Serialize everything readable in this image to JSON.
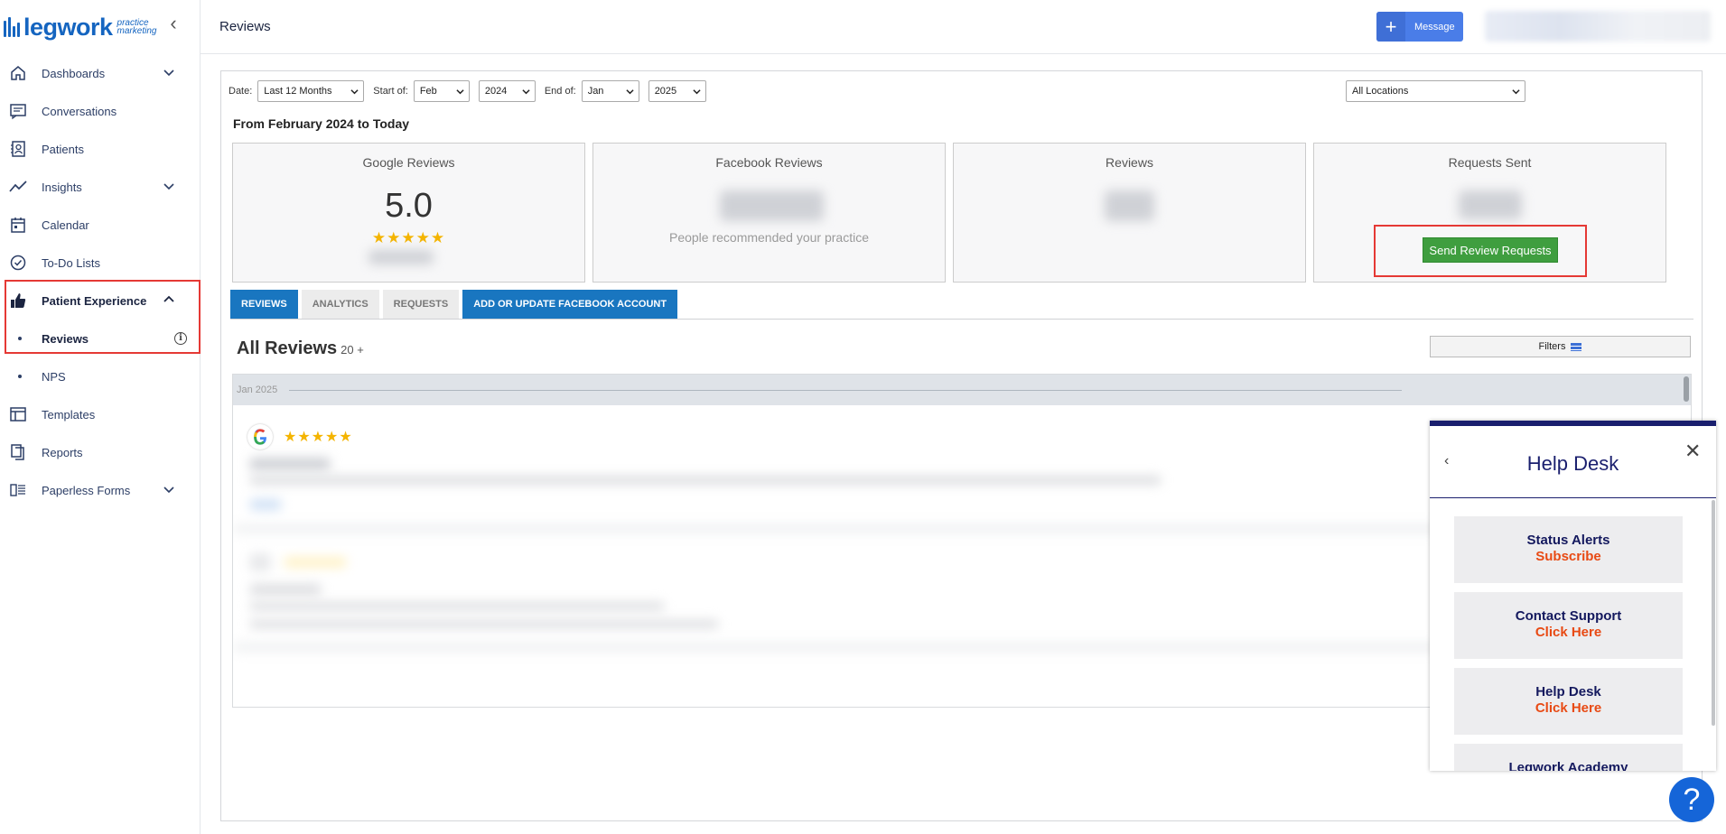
{
  "brand": {
    "name": "legwork",
    "sub1": "practice",
    "sub2": "marketing"
  },
  "sidebar": {
    "items": [
      {
        "label": "Dashboards",
        "icon": "home-icon"
      },
      {
        "label": "Conversations",
        "icon": "chat-icon"
      },
      {
        "label": "Patients",
        "icon": "contact-icon"
      },
      {
        "label": "Insights",
        "icon": "trend-icon"
      },
      {
        "label": "Calendar",
        "icon": "calendar-icon"
      },
      {
        "label": "To-Do Lists",
        "icon": "check-circle-icon"
      },
      {
        "label": "Patient Experience",
        "icon": "thumbs-up-icon"
      },
      {
        "label": "Reviews"
      },
      {
        "label": "NPS"
      },
      {
        "label": "Templates",
        "icon": "table-icon"
      },
      {
        "label": "Reports",
        "icon": "copy-icon"
      },
      {
        "label": "Paperless Forms",
        "icon": "forms-icon"
      }
    ],
    "info_symbol": "i"
  },
  "header": {
    "title": "Reviews",
    "message_label": "Message",
    "plus": "+"
  },
  "filters": {
    "date_label": "Date:",
    "date_value": "Last 12 Months",
    "start_label": "Start of:",
    "start_month": "Feb",
    "start_year": "2024",
    "end_label": "End of:",
    "end_month": "Jan",
    "end_year": "2025",
    "location": "All Locations"
  },
  "range_title": "From February 2024 to Today",
  "cards": {
    "google": {
      "title": "Google Reviews",
      "value": "5.0",
      "stars": "★★★★★"
    },
    "facebook": {
      "title": "Facebook Reviews",
      "sub": "People recommended your practice"
    },
    "reviews": {
      "title": "Reviews"
    },
    "requests": {
      "title": "Requests Sent",
      "button": "Send Review Requests"
    }
  },
  "tabs": [
    "REVIEWS",
    "ANALYTICS",
    "REQUESTS",
    "ADD OR UPDATE FACEBOOK ACCOUNT"
  ],
  "all_reviews": {
    "title": "All Reviews",
    "count": "20 +",
    "filters_label": "Filters"
  },
  "month_label": "Jan 2025",
  "review": {
    "stars": "★★★★★"
  },
  "help_desk": {
    "back": "‹",
    "title": "Help Desk",
    "close": "✕",
    "cards": [
      {
        "title": "Status Alerts",
        "action": "Subscribe"
      },
      {
        "title": "Contact Support",
        "action": "Click Here"
      },
      {
        "title": "Help Desk",
        "action": "Click Here"
      },
      {
        "title": "Legwork Academy",
        "action": ""
      }
    ],
    "help_button": "?"
  },
  "colors": {
    "accent": "#1976c0",
    "green": "#3f9e3f",
    "highlight": "#e53935",
    "help_navy": "#1a1f6e",
    "help_orange": "#e84a14"
  }
}
